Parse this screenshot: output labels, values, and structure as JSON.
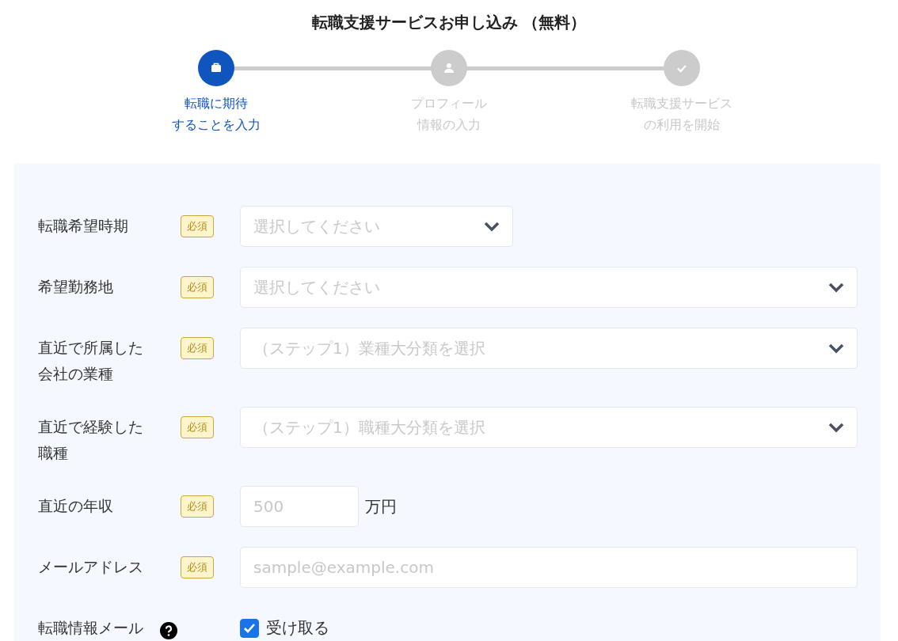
{
  "title": "転職支援サービスお申し込み （無料）",
  "steps": [
    {
      "lines": [
        "転職に期待",
        "することを入力"
      ],
      "active": true
    },
    {
      "lines": [
        "プロフィール",
        "情報の入力"
      ],
      "active": false
    },
    {
      "lines": [
        "転職支援サービス",
        "の利用を開始"
      ],
      "active": false
    }
  ],
  "form": {
    "rows": [
      {
        "kind": "select",
        "label": "転職希望時期",
        "badge": "必須",
        "placeholder": "選択してください",
        "narrow": true
      },
      {
        "kind": "select",
        "label": "希望勤務地",
        "badge": "必須",
        "placeholder": "選択してください"
      },
      {
        "kind": "select",
        "label": "直近で所属した会社の業種",
        "badge": "必須",
        "placeholder": "（ステップ1）業種大分類を選択"
      },
      {
        "kind": "select",
        "label": "直近で経験した職種",
        "badge": "必須",
        "placeholder": "（ステップ1）職種大分類を選択"
      },
      {
        "kind": "number",
        "label": "直近の年収",
        "badge": "必須",
        "placeholder": "500",
        "unit": "万円"
      },
      {
        "kind": "text",
        "label": "メールアドレス",
        "badge": "必須",
        "placeholder": "sample@example.com"
      },
      {
        "kind": "checkbox",
        "label": "転職情報メール",
        "help": true,
        "option": "受け取る",
        "checked": true
      }
    ]
  }
}
